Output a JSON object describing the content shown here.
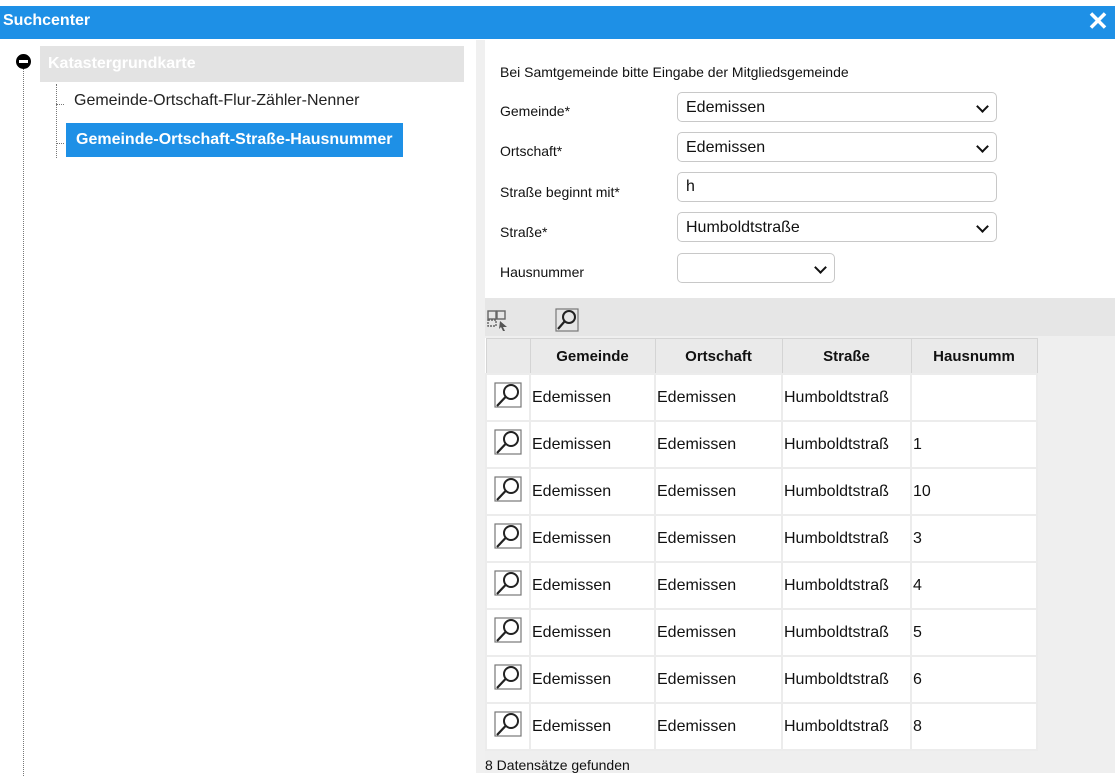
{
  "window": {
    "title": "Suchcenter",
    "close_label": "✕"
  },
  "tree": {
    "root_label": "Katastergrundkarte",
    "items": [
      {
        "label": "Gemeinde-Ortschaft-Flur-Zähler-Nenner"
      },
      {
        "label": "Gemeinde-Ortschaft-Straße-Hausnummer"
      }
    ]
  },
  "form": {
    "hint": "Bei Samtgemeinde bitte Eingabe der Mitgliedsgemeinde",
    "gemeinde": {
      "label": "Gemeinde*",
      "value": "Edemissen"
    },
    "ortschaft": {
      "label": "Ortschaft*",
      "value": "Edemissen"
    },
    "strasse_prefix": {
      "label": "Straße beginnt mit*",
      "value": "h"
    },
    "strasse": {
      "label": "Straße*",
      "value": "Humboldtstraße"
    },
    "hausnummer": {
      "label": "Hausnummer",
      "value": ""
    }
  },
  "table": {
    "headers": [
      "Gemeinde",
      "Ortschaft",
      "Straße",
      "Hausnumm"
    ],
    "rows": [
      [
        "Edemissen",
        "Edemissen",
        "Humboldtstraß",
        ""
      ],
      [
        "Edemissen",
        "Edemissen",
        "Humboldtstraß",
        "1"
      ],
      [
        "Edemissen",
        "Edemissen",
        "Humboldtstraß",
        "10"
      ],
      [
        "Edemissen",
        "Edemissen",
        "Humboldtstraß",
        "3"
      ],
      [
        "Edemissen",
        "Edemissen",
        "Humboldtstraß",
        "4"
      ],
      [
        "Edemissen",
        "Edemissen",
        "Humboldtstraß",
        "5"
      ],
      [
        "Edemissen",
        "Edemissen",
        "Humboldtstraß",
        "6"
      ],
      [
        "Edemissen",
        "Edemissen",
        "Humboldtstraß",
        "8"
      ]
    ]
  },
  "status": "8 Datensätze gefunden",
  "colors": {
    "accent": "#1e90e6"
  }
}
